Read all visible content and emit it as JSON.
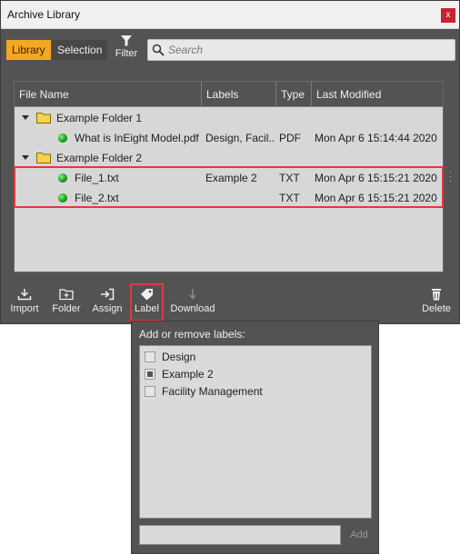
{
  "window": {
    "title": "Archive Library",
    "close_label": "x"
  },
  "tabs": [
    {
      "label": "Library"
    },
    {
      "label": "Selection"
    }
  ],
  "filter": {
    "label": "Filter"
  },
  "search": {
    "placeholder": "Search",
    "value": ""
  },
  "table": {
    "columns": [
      "File Name",
      "Labels",
      "Type",
      "Last Modified"
    ],
    "rows": [
      {
        "kind": "folder",
        "name": "Example Folder 1",
        "labels": "",
        "type": "",
        "modified": ""
      },
      {
        "kind": "file",
        "name": "What is InEight Model.pdf",
        "labels": "Design, Facil...",
        "type": "PDF",
        "modified": "Mon Apr 6 15:14:44 2020"
      },
      {
        "kind": "folder",
        "name": "Example Folder 2",
        "labels": "",
        "type": "",
        "modified": ""
      },
      {
        "kind": "file",
        "name": "File_1.txt",
        "labels": "Example 2",
        "type": "TXT",
        "modified": "Mon Apr 6 15:15:21 2020"
      },
      {
        "kind": "file",
        "name": "File_2.txt",
        "labels": "",
        "type": "TXT",
        "modified": "Mon Apr 6 15:15:21 2020"
      }
    ]
  },
  "toolbar": {
    "import": "Import",
    "folder": "Folder",
    "assign": "Assign",
    "label": "Label",
    "download": "Download",
    "delete": "Delete"
  },
  "label_popup": {
    "title": "Add or remove labels:",
    "options": [
      {
        "label": "Design",
        "state": "unchecked"
      },
      {
        "label": "Example 2",
        "state": "partial"
      },
      {
        "label": "Facility Management",
        "state": "unchecked"
      }
    ],
    "new_label_value": "",
    "add_label": "Add"
  },
  "colors": {
    "accent_tab": "#f5a623",
    "highlight_border": "#e0393e",
    "panel_bg": "#535353",
    "status_dot": "#1b9e1b"
  },
  "icons": [
    "close-icon",
    "filter-icon",
    "search-icon",
    "caret-down-icon",
    "folder-icon",
    "status-dot-icon",
    "import-icon",
    "new-folder-icon",
    "assign-icon",
    "tag-icon",
    "download-icon",
    "trash-icon"
  ]
}
